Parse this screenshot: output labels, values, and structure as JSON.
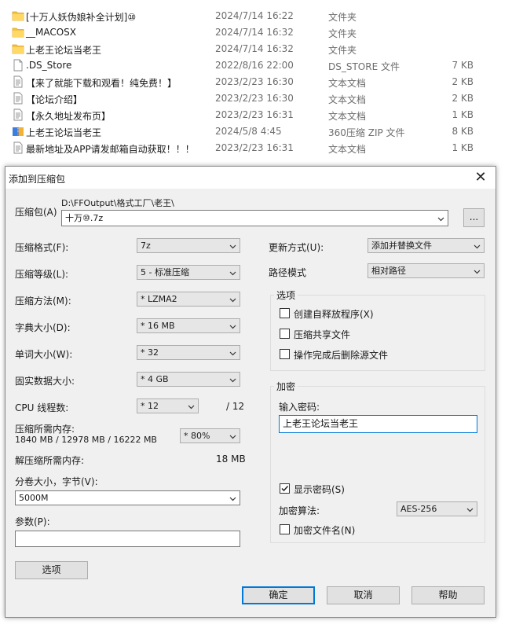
{
  "files": [
    {
      "name": "[十万人妖伪娘补全计划]⑩",
      "date": "2024/7/14 16:22",
      "type": "文件夹",
      "size": "",
      "icon": "folder-icon"
    },
    {
      "name": "__MACOSX",
      "date": "2024/7/14 16:32",
      "type": "文件夹",
      "size": "",
      "icon": "folder-icon"
    },
    {
      "name": "上老王论坛当老王",
      "date": "2024/7/14 16:32",
      "type": "文件夹",
      "size": "",
      "icon": "folder-icon"
    },
    {
      "name": ".DS_Store",
      "date": "2022/8/16 22:00",
      "type": "DS_STORE 文件",
      "size": "7 KB",
      "icon": "file-icon"
    },
    {
      "name": "【来了就能下载和观看！纯免费！】",
      "date": "2023/2/23 16:30",
      "type": "文本文档",
      "size": "2 KB",
      "icon": "text-document-icon"
    },
    {
      "name": "【论坛介绍】",
      "date": "2023/2/23 16:30",
      "type": "文本文档",
      "size": "2 KB",
      "icon": "text-document-icon"
    },
    {
      "name": "【永久地址发布页】",
      "date": "2023/2/23 16:31",
      "type": "文本文档",
      "size": "1 KB",
      "icon": "text-document-icon"
    },
    {
      "name": "上老王论坛当老王",
      "date": "2024/5/8 4:45",
      "type": "360压缩 ZIP 文件",
      "size": "8 KB",
      "icon": "zip-archive-icon"
    },
    {
      "name": "最新地址及APP请发邮箱自动获取！！！",
      "date": "2023/2/23 16:31",
      "type": "文本文档",
      "size": "1 KB",
      "icon": "text-document-icon"
    }
  ],
  "dialog": {
    "title": "添加到压缩包",
    "archive": {
      "label": "压缩包(A)",
      "path": "D:\\FFOutput\\格式工厂\\老王\\",
      "value": "十万⑩.7z",
      "browse_label": "..."
    },
    "format": {
      "label": "压缩格式(F):",
      "value": "7z"
    },
    "level": {
      "label": "压缩等级(L):",
      "value": "5 - 标准压缩"
    },
    "method": {
      "label": "压缩方法(M):",
      "value": "*  LZMA2"
    },
    "dict": {
      "label": "字典大小(D):",
      "value": "*  16 MB"
    },
    "word": {
      "label": "单词大小(W):",
      "value": "*  32"
    },
    "solid": {
      "label": "固实数据大小:",
      "value": "*  4 GB"
    },
    "threads": {
      "label": "CPU 线程数:",
      "value": "*  12",
      "max": "/ 12"
    },
    "memory": {
      "label": "压缩所需内存:",
      "detail": "1840 MB / 12978 MB / 16222 MB",
      "value": "* 80%"
    },
    "decomp": {
      "label": "解压缩所需内存:",
      "value": "18 MB"
    },
    "volume": {
      "label": "分卷大小，字节(V):",
      "value": "5000M"
    },
    "params": {
      "label": "参数(P):",
      "value": ""
    },
    "options_button": "选项",
    "update": {
      "label": "更新方式(U):",
      "value": "添加并替换文件"
    },
    "pathmode": {
      "label": "路径模式",
      "value": "相对路径"
    },
    "options_group": {
      "title": "选项",
      "sfx": {
        "label": "创建自释放程序(X)",
        "checked": false
      },
      "shared": {
        "label": "压缩共享文件",
        "checked": false
      },
      "delete": {
        "label": "操作完成后删除源文件",
        "checked": false
      }
    },
    "encryption": {
      "title": "加密",
      "password_label": "输入密码:",
      "password_value": "上老王论坛当老王",
      "show_password": {
        "label": "显示密码(S)",
        "checked": true
      },
      "method_label": "加密算法:",
      "method_value": "AES-256",
      "encrypt_names": {
        "label": "加密文件名(N)",
        "checked": false
      }
    },
    "ok_button": "确定",
    "cancel_button": "取消",
    "help_button": "帮助"
  }
}
